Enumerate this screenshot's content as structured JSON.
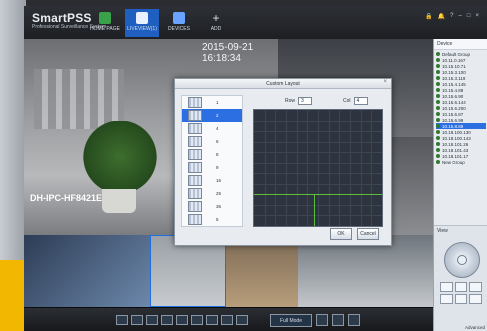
{
  "app": {
    "brand_name": "SmartPSS",
    "brand_subtitle": "Professional Surveillance System",
    "top_nav": [
      {
        "label": "HOME PAGE"
      },
      {
        "label": "LIVEVIEW(1)"
      },
      {
        "label": "DEVICES"
      },
      {
        "label": "ADD"
      }
    ],
    "top_right_icons": [
      "lock-icon",
      "bell-icon",
      "question-icon",
      "minimize-icon",
      "maximize-icon",
      "close-icon"
    ]
  },
  "video": {
    "main_timestamp": "2015-09-21 16:18:34",
    "main_camera_name": "DH-IPC-HF8421E"
  },
  "dialog": {
    "title": "Custom Layout",
    "row_label": "Row",
    "row_value": "3",
    "col_label": "Col",
    "col_value": "4",
    "layouts": [
      "1",
      "2",
      "4",
      "6",
      "8",
      "9",
      "16",
      "25",
      "36",
      "5"
    ],
    "selected_layout_index": 1,
    "ok_label": "OK",
    "cancel_label": "Cancel"
  },
  "sidebar": {
    "device_title": "Device",
    "tree": [
      "Default Group",
      "10.11.0.167",
      "10.15.10.71",
      "10.15.3.100",
      "10.15.3.119",
      "10.15.4.145",
      "10.15.4.88",
      "10.15.6.90",
      "10.15.6.144",
      "10.15.6.200",
      "10.15.6.87",
      "10.15.6.99",
      "10.15.8.89",
      "10.18.100.130",
      "10.18.100.143",
      "10.18.101.26",
      "10.18.101.43",
      "10.18.101.17",
      "New Group"
    ],
    "selected_tree_index": 12,
    "view_title": "View",
    "advanced_label": "Advanced"
  },
  "bottom": {
    "fullscreen_label": "Full Mode"
  }
}
